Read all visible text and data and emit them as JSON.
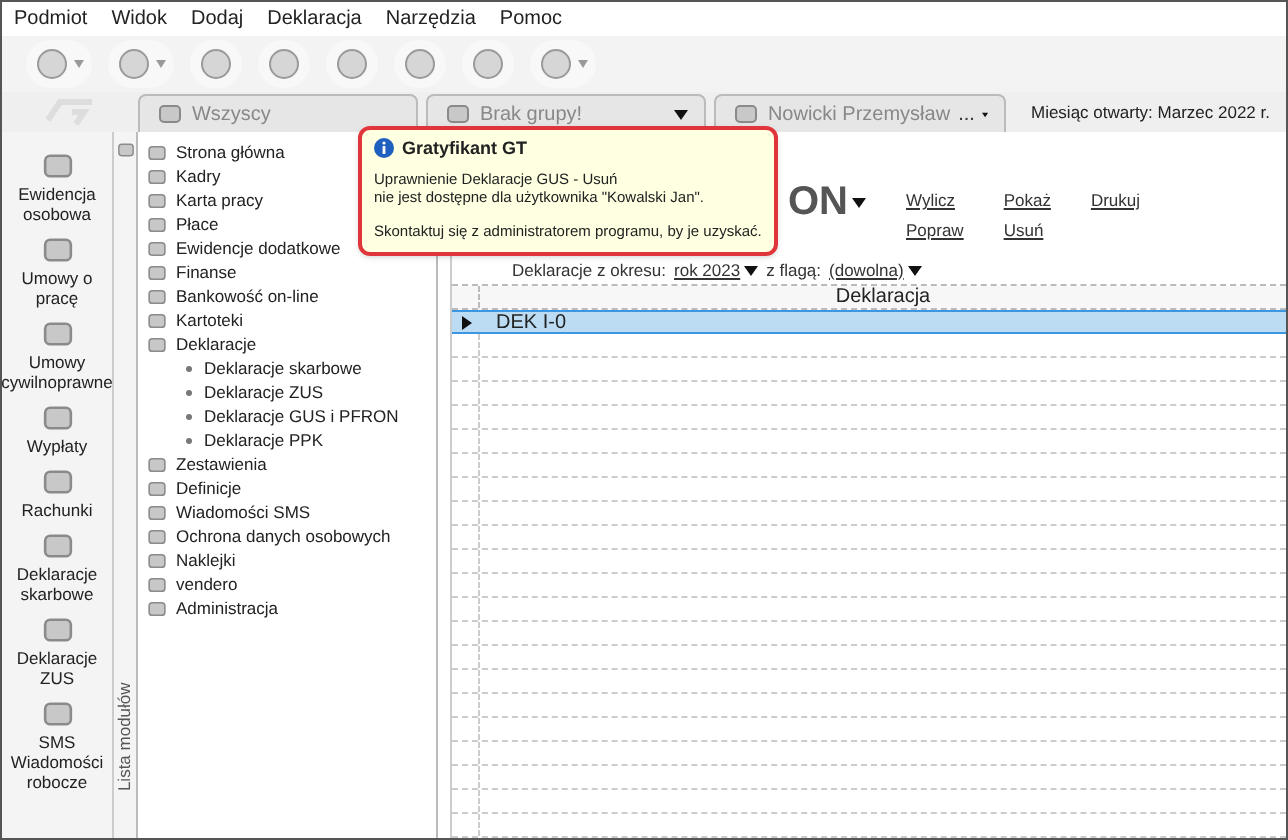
{
  "menu": [
    "Podmiot",
    "Widok",
    "Dodaj",
    "Deklaracja",
    "Narzędzia",
    "Pomoc"
  ],
  "toolbar": [
    {
      "dropdown": true
    },
    {
      "dropdown": true
    },
    {
      "dropdown": false
    },
    {
      "dropdown": false
    },
    {
      "dropdown": false
    },
    {
      "dropdown": false
    },
    {
      "dropdown": false
    },
    {
      "dropdown": true
    }
  ],
  "tabs": [
    {
      "label": "Wszyscy",
      "dropdown": false
    },
    {
      "label": "Brak grupy!",
      "dropdown": true
    },
    {
      "label": "Nowicki Przemysław",
      "extra": "...",
      "dropdown": true
    }
  ],
  "month": "Miesiąc otwarty:  Marzec 2022 r.",
  "sidebar": [
    "Ewidencja osobowa",
    "Umowy o pracę",
    "Umowy cywilnoprawne",
    "Wypłaty",
    "Rachunki",
    "Deklaracje skarbowe",
    "Deklaracje ZUS",
    "SMS Wiadomości robocze"
  ],
  "modules_label": "Lista modułów",
  "tree": [
    {
      "label": "Strona główna"
    },
    {
      "label": "Kadry"
    },
    {
      "label": "Karta pracy"
    },
    {
      "label": "Płace"
    },
    {
      "label": "Ewidencje dodatkowe"
    },
    {
      "label": "Finanse"
    },
    {
      "label": "Bankowość on-line"
    },
    {
      "label": "Kartoteki"
    },
    {
      "label": "Deklaracje",
      "children": [
        {
          "label": "Deklaracje skarbowe"
        },
        {
          "label": "Deklaracje ZUS"
        },
        {
          "label": "Deklaracje GUS i PFRON"
        },
        {
          "label": "Deklaracje PPK"
        }
      ]
    },
    {
      "label": "Zestawienia"
    },
    {
      "label": "Definicje"
    },
    {
      "label": "Wiadomości SMS"
    },
    {
      "label": "Ochrona danych osobowych"
    },
    {
      "label": "Naklejki"
    },
    {
      "label": "vendero"
    },
    {
      "label": "Administracja"
    }
  ],
  "main": {
    "title_visible": "ON",
    "actions": [
      [
        "Wylicz",
        "Popraw"
      ],
      [
        "Pokaż",
        "Usuń"
      ],
      [
        "Drukuj"
      ]
    ],
    "filter": {
      "period_label": "Deklaracje z okresu:",
      "period": "rok 2023",
      "flag_label": "z flagą:",
      "flag": "(dowolna)"
    },
    "table": {
      "columns": [
        "Deklaracja"
      ],
      "rows": [
        {
          "cells": [
            "DEK I-0"
          ],
          "selected": true
        }
      ]
    }
  },
  "tooltip": {
    "title": "Gratyfikant GT",
    "lines": [
      "Uprawnienie Deklaracje GUS - Usuń",
      "nie jest dostępne dla użytkownika \"Kowalski Jan\"."
    ],
    "note": "Skontaktuj się z administratorem programu, by je uzyskać."
  }
}
